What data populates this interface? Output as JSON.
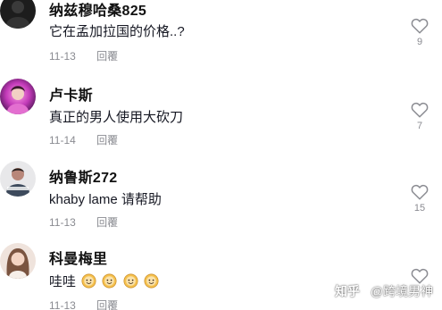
{
  "comments": [
    {
      "username": "纳兹穆哈桑825",
      "text": "它在孟加拉国的价格..?",
      "date": "11-13",
      "reply_label": "回覆",
      "likes": "9",
      "avatar_icon": "dark-profile-avatar"
    },
    {
      "username": "卢卡斯",
      "text": "真正的男人使用大砍刀",
      "date": "11-14",
      "reply_label": "回覆",
      "likes": "7",
      "avatar_icon": "pink-portrait-avatar"
    },
    {
      "username": "纳鲁斯272",
      "text": "khaby lame 请帮助",
      "date": "11-13",
      "reply_label": "回覆",
      "likes": "15",
      "avatar_icon": "man-portrait-avatar"
    },
    {
      "username": "科曼梅里",
      "text": "哇哇",
      "emoji_count": 4,
      "emoji_icon": "smiling-face-emoji",
      "date": "11-13",
      "reply_label": "回覆",
      "likes": "",
      "avatar_icon": "woman-portrait-avatar"
    }
  ],
  "watermark": {
    "prefix": "知乎",
    "handle": "@跨境男神"
  },
  "colors": {
    "text_primary": "#161823",
    "text_secondary": "#8a8b91",
    "heart_outline": "#8a8b91"
  }
}
